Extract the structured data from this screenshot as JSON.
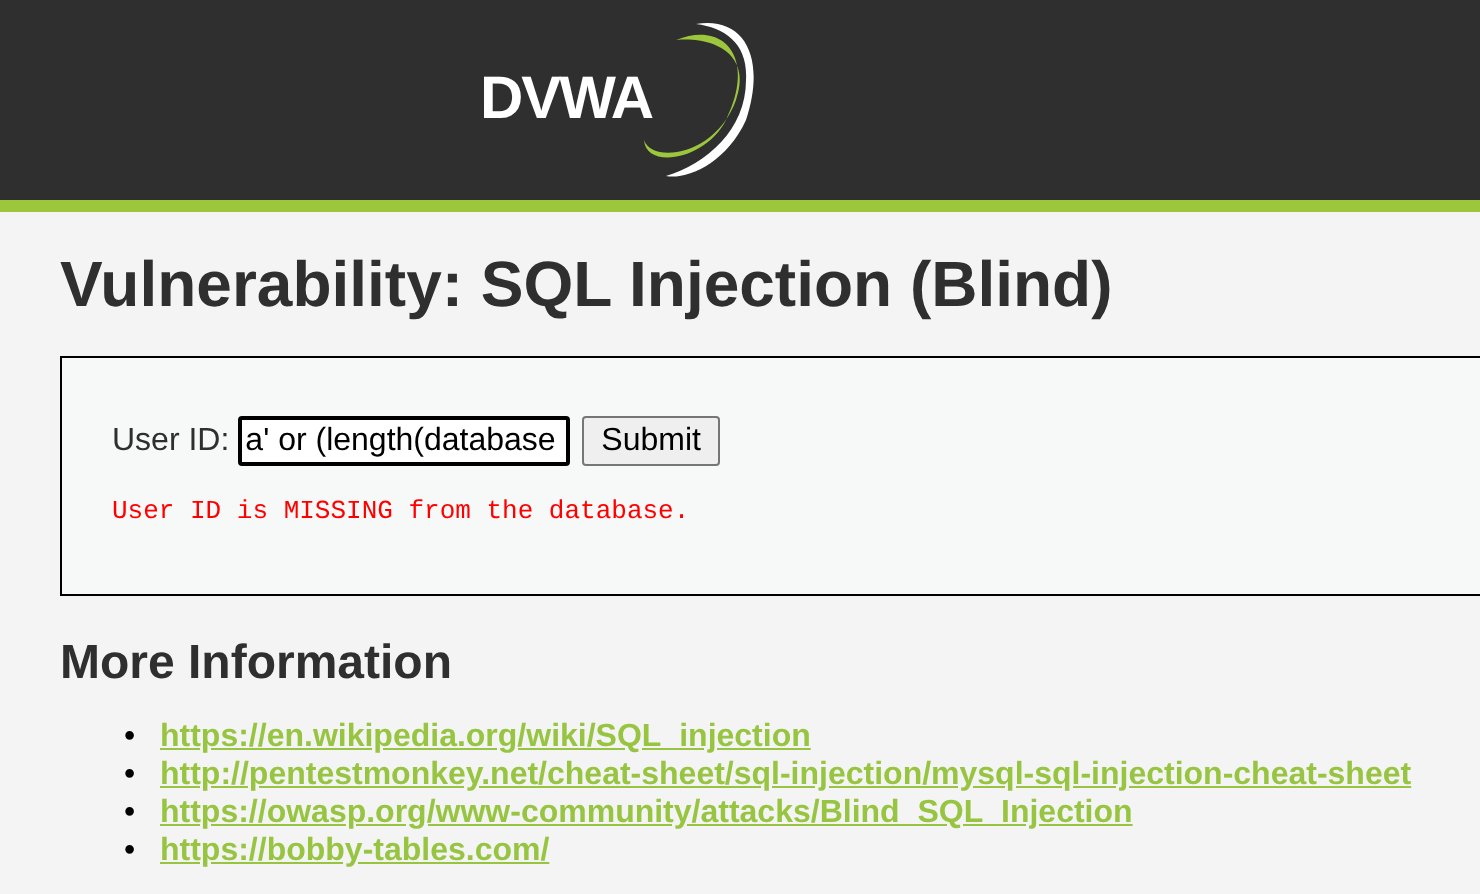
{
  "header": {
    "logo": "DVWA"
  },
  "title": "Vulnerability: SQL Injection (Blind)",
  "form": {
    "label": "User ID:",
    "input_value": "a' or (length(database",
    "button": "Submit",
    "message": "User ID is MISSING from the database."
  },
  "more_information": {
    "heading": "More Information",
    "links": [
      {
        "bullet": "•",
        "url": "https://en.wikipedia.org/wiki/SQL_injection"
      },
      {
        "bullet": "•",
        "url": "http://pentestmonkey.net/cheat-sheet/sql-injection/mysql-sql-injection-cheat-sheet"
      },
      {
        "bullet": "•",
        "url": "https://owasp.org/www-community/attacks/Blind_SQL_Injection"
      },
      {
        "bullet": "•",
        "url": "https://bobby-tables.com/"
      }
    ]
  }
}
